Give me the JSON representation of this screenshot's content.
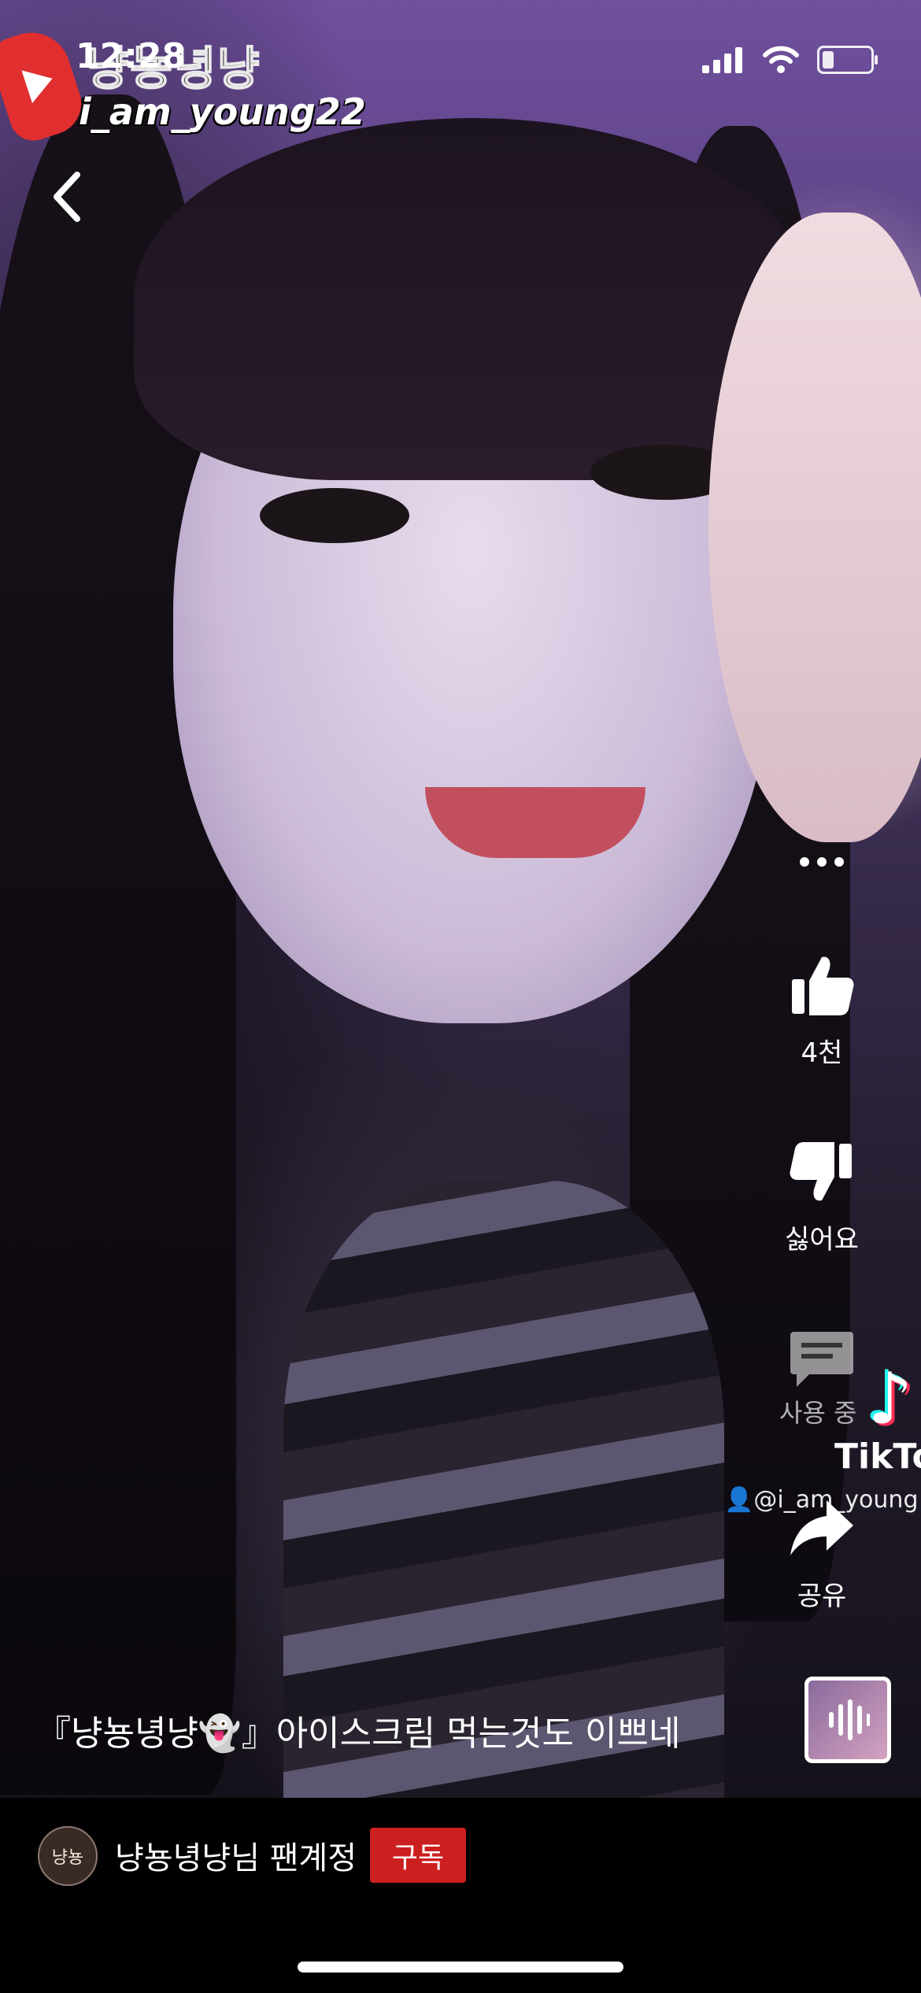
{
  "status_bar": {
    "time": "12:28"
  },
  "watermark": {
    "channel": "냥뇽녕냥",
    "username": "i_am_young22"
  },
  "actions": {
    "like_count": "4천",
    "dislike_label": "싫어요",
    "comment_label": "사용 중",
    "share_label": "공유"
  },
  "tiktok": {
    "logo_text": "TikTok",
    "user": "@i_am_young"
  },
  "caption": "『냥뇽녕냥👻』아이스크림 먹는것도 이쁘네",
  "channel": {
    "avatar_text": "냥뇽",
    "name": "냥뇽녕냥님 팬계정",
    "subscribe_label": "구독"
  },
  "colors": {
    "subscribe": "#cc1f1f",
    "watermark_logo": "#e12f2f"
  }
}
